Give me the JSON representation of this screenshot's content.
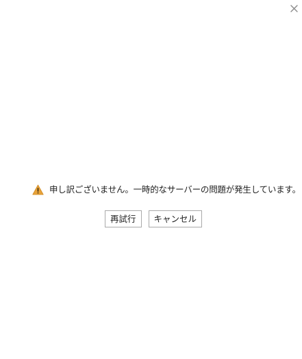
{
  "dialog": {
    "close_icon": "close-icon",
    "message": "申し訳ございません。一時的なサーバーの問題が発生しています。",
    "warning_icon": "warning-icon",
    "warning_color": "#e8a33a",
    "buttons": {
      "retry_label": "再試行",
      "cancel_label": "キャンセル"
    }
  }
}
